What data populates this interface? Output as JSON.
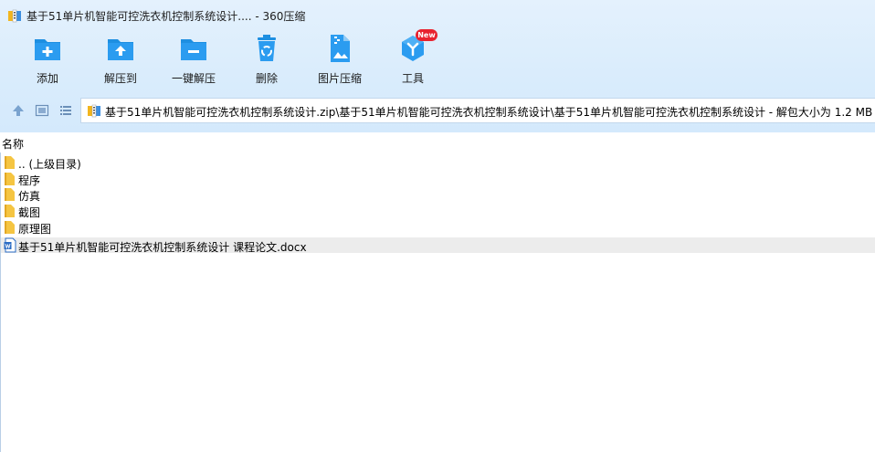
{
  "window": {
    "title": "基于51单片机智能可控洗衣机控制系统设计.... - 360压缩",
    "logo_icon": "archive-logo-icon"
  },
  "toolbar": {
    "items": [
      {
        "label": "添加",
        "icon": "add-icon"
      },
      {
        "label": "解压到",
        "icon": "extract-to-icon"
      },
      {
        "label": "一键解压",
        "icon": "one-click-extract-icon"
      },
      {
        "label": "删除",
        "icon": "recycle-delete-icon"
      },
      {
        "label": "图片压缩",
        "icon": "image-compress-icon"
      },
      {
        "label": "工具",
        "icon": "tools-icon"
      }
    ],
    "new_badge": "New"
  },
  "address": {
    "path": "基于51单片机智能可控洗衣机控制系统设计.zip\\基于51单片机智能可控洗衣机控制系统设计\\基于51单片机智能可控洗衣机控制系统设计 - 解包大小为 1.2 MB"
  },
  "list": {
    "column_name": "名称",
    "rows": [
      {
        "label": ".. (上级目录)",
        "type": "folder"
      },
      {
        "label": "程序",
        "type": "folder"
      },
      {
        "label": "仿真",
        "type": "folder"
      },
      {
        "label": "截图",
        "type": "folder"
      },
      {
        "label": "原理图",
        "type": "folder"
      },
      {
        "label": "基于51单片机智能可控洗衣机控制系统设计 课程论文.docx",
        "type": "docx",
        "selected": true
      }
    ]
  },
  "colors": {
    "header_bg": "#dcedfc",
    "accent": "#1e8fe1",
    "folder": "#f5c542",
    "new_badge": "#e8222f",
    "selected_row": "#ececec"
  }
}
